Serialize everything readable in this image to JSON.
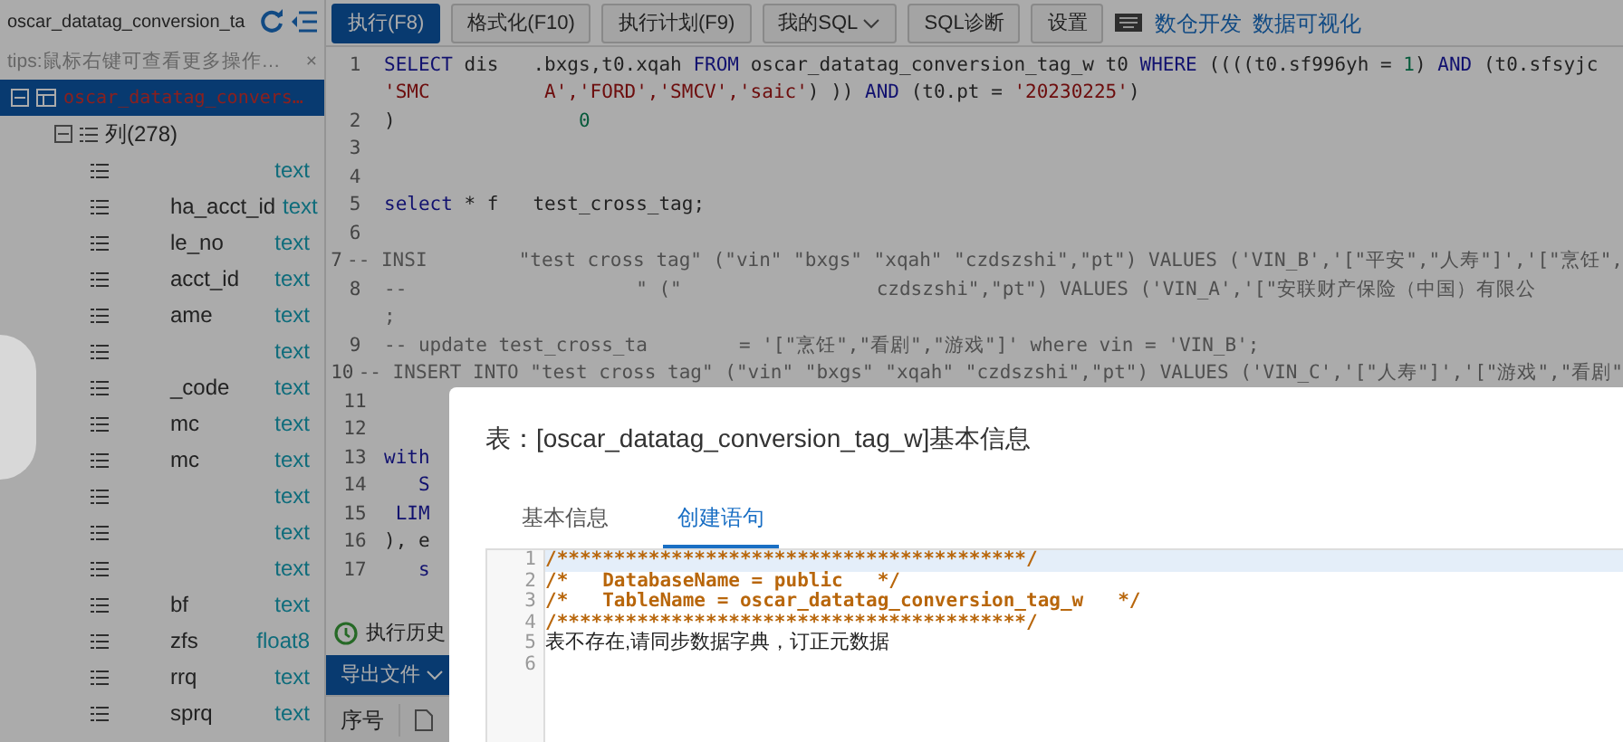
{
  "sidebar": {
    "search": {
      "value": "oscar_datatag_conversion_ta"
    },
    "tips": "tips:鼠标右键可查看更多操作…",
    "tips_close": "×",
    "tree": [
      {
        "label": "oscar_datatag_convers…",
        "selected": true,
        "expanded": true,
        "children": [
          {
            "label": "列(278)",
            "expanded": true,
            "children": [
              {
                "type": "text"
              },
              {
                "name": "ha_acct_id",
                "type": "text"
              },
              {
                "name": "le_no",
                "type": "text"
              },
              {
                "name": "acct_id",
                "type": "text"
              },
              {
                "name": "ame",
                "type": "text"
              },
              {
                "type": "text"
              },
              {
                "name": "_code",
                "type": "text"
              },
              {
                "name": "mc",
                "type": "text"
              },
              {
                "name": "mc",
                "type": "text"
              },
              {
                "type": "text"
              },
              {
                "type": "text"
              },
              {
                "type": "text"
              },
              {
                "name": "bf",
                "type": "text"
              },
              {
                "name": "zfs",
                "type": "float8"
              },
              {
                "name": "rrq",
                "type": "text"
              },
              {
                "name": "sprq",
                "type": "text"
              }
            ]
          }
        ]
      }
    ]
  },
  "toolbar": {
    "buttons": [
      {
        "label": "执行(F8)",
        "primary": true
      },
      {
        "label": "格式化(F10)",
        "primary": false
      },
      {
        "label": "执行计划(F9)",
        "primary": false
      },
      {
        "label": "我的SQL",
        "primary": false,
        "dropdown": true
      },
      {
        "label": "SQL诊断",
        "primary": false
      },
      {
        "label": "设置",
        "primary": false
      }
    ],
    "links": [
      "数仓开发",
      "数据可视化"
    ]
  },
  "editor": {
    "lines": [
      {
        "number": "1",
        "segments": [
          {
            "kind": "keyword",
            "text": "SELECT"
          },
          {
            "kind": "plain",
            "text": " dis   .bxgs,t0.xqah "
          },
          {
            "kind": "keyword",
            "text": "FROM"
          },
          {
            "kind": "plain",
            "text": " oscar_datatag_conversion_tag_w t0 "
          },
          {
            "kind": "keyword",
            "text": "WHERE"
          },
          {
            "kind": "plain",
            "text": " ((((t0.sf996yh = "
          },
          {
            "kind": "number",
            "text": "1"
          },
          {
            "kind": "plain",
            "text": ") "
          },
          {
            "kind": "keyword",
            "text": "AND"
          },
          {
            "kind": "plain",
            "text": " (t0.sfsyjc"
          }
        ]
      },
      {
        "segments": [
          {
            "kind": "string",
            "text": "'SMC"
          },
          {
            "kind": "string",
            "text": "          A','FORD','SMCV','saic'"
          },
          {
            "kind": "plain",
            "text": ") )) "
          },
          {
            "kind": "keyword",
            "text": "AND"
          },
          {
            "kind": "plain",
            "text": " (t0.pt = "
          },
          {
            "kind": "string",
            "text": "'20230225'"
          },
          {
            "kind": "plain",
            "text": ")"
          }
        ]
      },
      {
        "number": "2",
        "segments": [
          {
            "kind": "plain",
            "text": ")"
          },
          {
            "kind": "number",
            "text": "                0"
          }
        ]
      },
      {
        "number": "3"
      },
      {
        "number": "4"
      },
      {
        "number": "5",
        "segments": [
          {
            "kind": "keyword",
            "text": "select"
          },
          {
            "kind": "plain",
            "text": " * f   test_cross_tag;"
          }
        ]
      },
      {
        "number": "6"
      },
      {
        "number": "7",
        "segments": [
          {
            "kind": "comment",
            "text": "-- INSI        \"test cross tag\" (\"vin\" \"bxgs\" \"xqah\" \"czdszshi\",\"pt\") VALUES ('VIN_B','[\"平安\",\"人寿\"]','[\"烹饪\","
          }
        ]
      },
      {
        "number": "8",
        "segments": [
          {
            "kind": "comment",
            "text": "--                    \" (\"                 czdszshi\",\"pt\") VALUES ('VIN_A','[\"安联财产保险（中国）有限公"
          }
        ]
      },
      {
        "segments": [
          {
            "kind": "comment",
            "text": ";"
          }
        ]
      },
      {
        "number": "9",
        "segments": [
          {
            "kind": "comment",
            "text": "-- update test_cross_ta        = '[\"烹饪\",\"看剧\",\"游戏\"]' where vin = 'VIN_B';"
          }
        ]
      },
      {
        "number": "10",
        "segments": [
          {
            "kind": "comment",
            "text": "-- INSERT INTO \"test cross tag\" (\"vin\" \"bxgs\" \"xqah\" \"czdszshi\",\"pt\") VALUES ('VIN_C','[\"人寿\"]','[\"游戏\",\"看剧\""
          }
        ]
      },
      {
        "number": "11"
      },
      {
        "number": "12"
      },
      {
        "number": "13",
        "segments": [
          {
            "kind": "keyword",
            "text": "with"
          }
        ]
      },
      {
        "number": "14",
        "segments": [
          {
            "kind": "keyword",
            "text": "   S"
          }
        ]
      },
      {
        "number": "15",
        "segments": [
          {
            "kind": "keyword",
            "text": " LIM"
          }
        ]
      },
      {
        "number": "16",
        "segments": [
          {
            "kind": "plain",
            "text": "), e"
          }
        ]
      },
      {
        "number": "17",
        "segments": [
          {
            "kind": "keyword",
            "text": "   s"
          }
        ]
      }
    ]
  },
  "bottom": {
    "history": "执行历史",
    "export": "导出文件",
    "columns": [
      "序号"
    ]
  },
  "modal": {
    "title": "表：[oscar_datatag_conversion_tag_w]基本信息",
    "tabs": [
      {
        "label": "基本信息",
        "selected": false
      },
      {
        "label": "创建语句",
        "selected": true
      }
    ],
    "code": [
      {
        "number": "1",
        "kind": "comment",
        "text": "/*****************************************/",
        "highlighted": true
      },
      {
        "number": "2",
        "kind": "comment",
        "text": "/*   DatabaseName = public   */",
        "highlighted": false
      },
      {
        "number": "3",
        "kind": "comment",
        "text": "/*   TableName = oscar_datatag_conversion_tag_w   */",
        "highlighted": false
      },
      {
        "number": "4",
        "kind": "comment",
        "text": "/*****************************************/",
        "highlighted": false
      },
      {
        "number": "5",
        "kind": "plain",
        "text": "表不存在,请同步数据字典，订正元数据",
        "highlighted": false
      },
      {
        "number": "6",
        "kind": "plain",
        "highlighted": false
      }
    ]
  }
}
